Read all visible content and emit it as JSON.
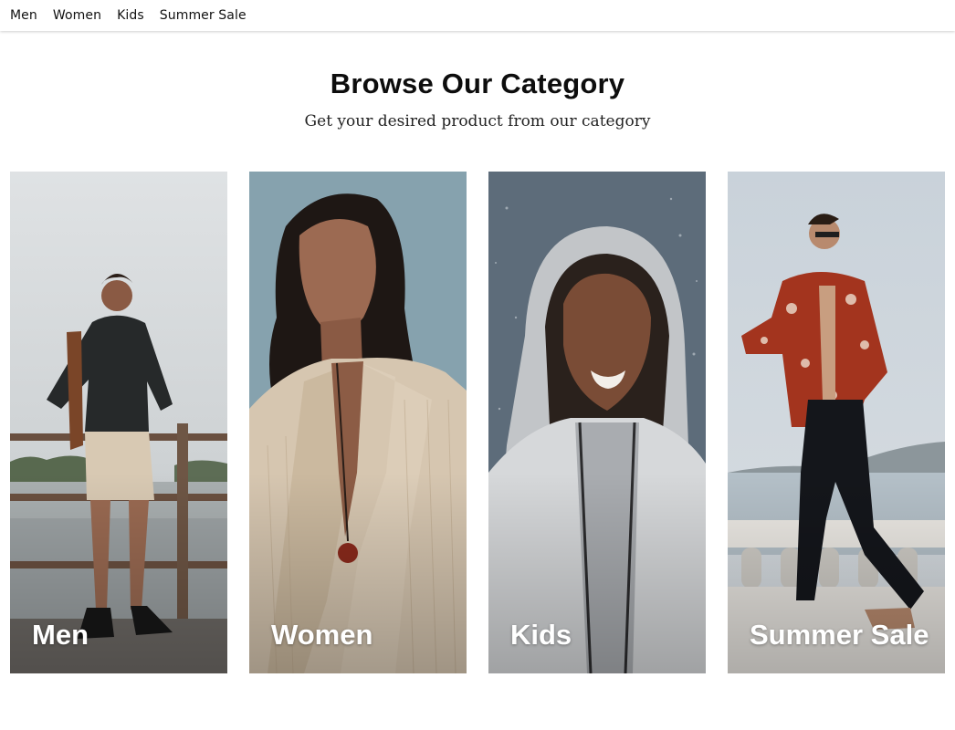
{
  "nav": {
    "items": [
      {
        "label": "Men"
      },
      {
        "label": "Women"
      },
      {
        "label": "Kids"
      },
      {
        "label": "Summer Sale"
      }
    ]
  },
  "section": {
    "title": "Browse Our Category",
    "subtitle": "Get your desired product from our category"
  },
  "categories": [
    {
      "label": "Men"
    },
    {
      "label": "Women"
    },
    {
      "label": "Kids"
    },
    {
      "label": "Summer Sale"
    }
  ],
  "colors": {
    "background": "#ffffff",
    "text": "#111111",
    "card_label": "#ffffff"
  }
}
